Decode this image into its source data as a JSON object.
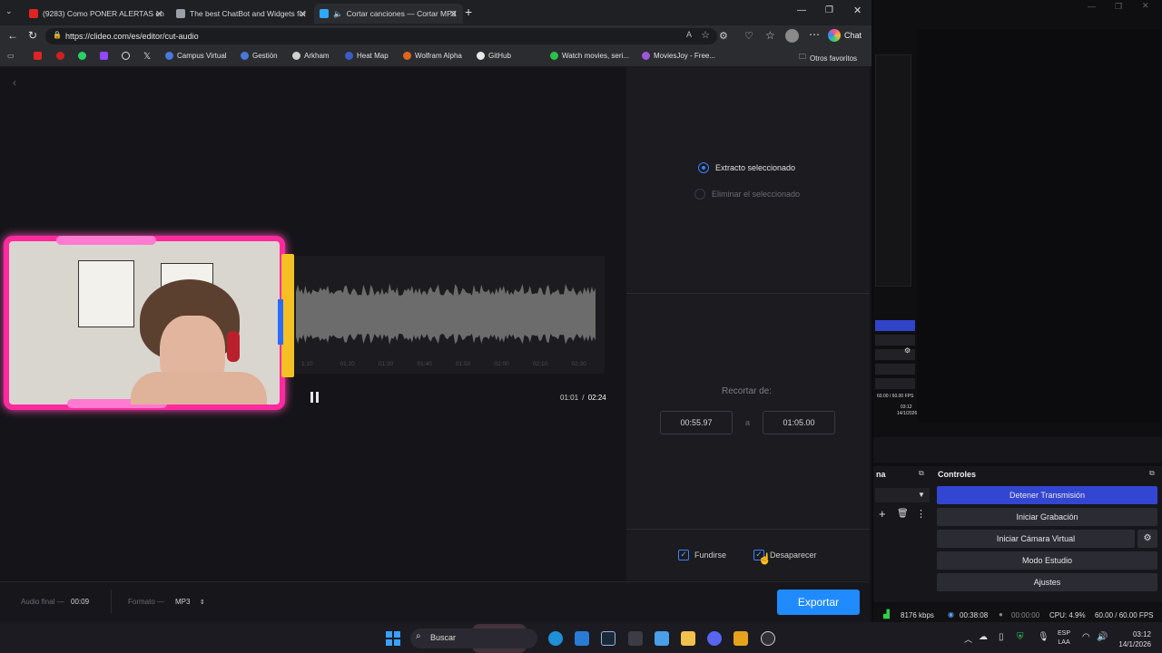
{
  "tabs": [
    {
      "title": "(9283) Como PONER ALERTAS en",
      "color": "#e02424"
    },
    {
      "title": "The best ChatBot and Widgets for",
      "color": "#9aa0a6"
    },
    {
      "title": "Cortar canciones — Cortar MP3",
      "color": "#2ea8ff"
    }
  ],
  "browser": {
    "url": "https://clideo.com/es/editor/cut-audio",
    "chat_label": "Chat"
  },
  "bookmarks": [
    {
      "label": "Campus Virtual",
      "color": "#4a78d8"
    },
    {
      "label": "Gestión",
      "color": "#4a78d8"
    },
    {
      "label": "Arkham",
      "color": "#cfcfcf"
    },
    {
      "label": "Heat Map",
      "color": "#3b5cc8"
    },
    {
      "label": "Wolfram Alpha",
      "color": "#e0651f"
    },
    {
      "label": "GitHub",
      "color": "#e8e8e8"
    },
    {
      "label": "Watch movies, seri...",
      "color": "#2bc24a"
    },
    {
      "label": "MoviesJoy - Free...",
      "color": "#9b59d8"
    }
  ],
  "other_favorites": "Otros favoritos",
  "editor": {
    "options": {
      "selected": "Extracto seleccionado",
      "delete": "Eliminar el seleccionado"
    },
    "trim_label": "Recortar de:",
    "trim_from": "00:55.97",
    "trim_sep": "a",
    "trim_to": "01:05.00",
    "time_current": "01:01",
    "time_sep": "/",
    "time_total": "02:24",
    "ticks": [
      "1:10",
      "01:20",
      "01:30",
      "01:40",
      "01:50",
      "02:00",
      "02:10",
      "02:20"
    ],
    "fade_in": "Fundirse",
    "fade_out": "Desaparecer",
    "final_audio_label": "Audio final —",
    "final_audio_value": "00:09",
    "format_label": "Formato —",
    "format_value": "MP3",
    "export": "Exportar"
  },
  "obs": {
    "scene_label": "na",
    "controls_title": "Controles",
    "buttons": [
      "Detener Transmisión",
      "Iniciar Grabación",
      "Iniciar Cámara Virtual",
      "Modo Estudio",
      "Ajustes"
    ],
    "status": {
      "bitrate": "8176 kbps",
      "live_time": "00:38:08",
      "rec_time": "00:00:00",
      "cpu": "CPU: 4.9%",
      "fps": "60.00 / 60.00 FPS"
    },
    "mini_fps": "60.00 / 60.00 FPS",
    "mini_time": "03:12",
    "mini_date": "14/1/2026"
  },
  "taskbar": {
    "search": "Buscar",
    "lang_top": "ESP",
    "lang_bottom": "LAA",
    "time": "03:12",
    "date": "14/1/2026"
  }
}
